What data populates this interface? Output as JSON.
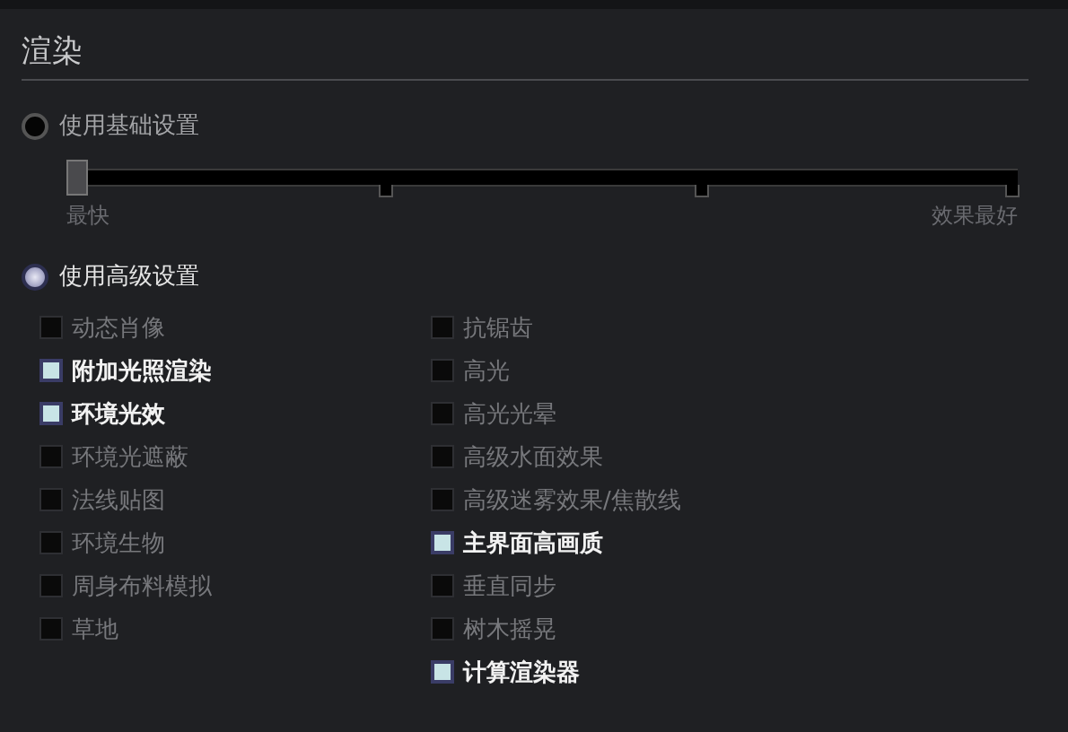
{
  "section_title": "渲染",
  "modes": [
    {
      "label": "使用基础设置",
      "selected": false
    },
    {
      "label": "使用高级设置",
      "selected": true
    }
  ],
  "quality_slider": {
    "level": 0,
    "min_label": "最快",
    "max_label": "效果最好"
  },
  "options": [
    [
      {
        "label": "动态肖像",
        "checked": false
      },
      {
        "label": "附加光照渲染",
        "checked": true
      },
      {
        "label": "环境光效",
        "checked": true
      },
      {
        "label": "环境光遮蔽",
        "checked": false
      },
      {
        "label": "法线贴图",
        "checked": false
      },
      {
        "label": "环境生物",
        "checked": false
      },
      {
        "label": "周身布料模拟",
        "checked": false
      },
      {
        "label": "草地",
        "checked": false
      }
    ],
    [
      {
        "label": "抗锯齿",
        "checked": false
      },
      {
        "label": "高光",
        "checked": false
      },
      {
        "label": "高光光晕",
        "checked": false
      },
      {
        "label": "高级水面效果",
        "checked": false
      },
      {
        "label": "高级迷雾效果/焦散线",
        "checked": false
      },
      {
        "label": "主界面高画质",
        "checked": true
      },
      {
        "label": "垂直同步",
        "checked": false
      },
      {
        "label": "树木摇晃",
        "checked": false
      },
      {
        "label": "计算渲染器",
        "checked": true
      }
    ]
  ]
}
